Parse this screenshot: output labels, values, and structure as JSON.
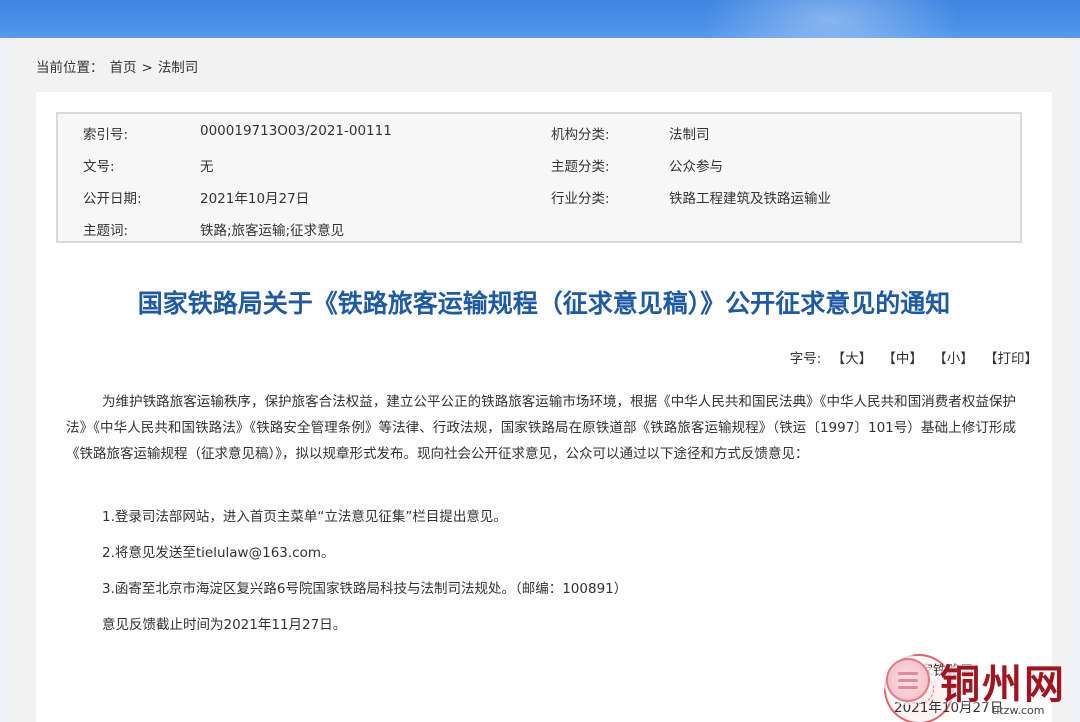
{
  "breadcrumb": {
    "prefix": "当前位置：",
    "home": "首页",
    "separator": ">",
    "current": "法制司"
  },
  "meta": {
    "rows": [
      {
        "k1": "索引号:",
        "v1": "000019713O03/2021-00111",
        "k2": "机构分类:",
        "v2": "法制司"
      },
      {
        "k1": "文号:",
        "v1": "无",
        "k2": "主题分类:",
        "v2": "公众参与"
      },
      {
        "k1": "公开日期:",
        "v1": "2021年10月27日",
        "k2": "行业分类:",
        "v2": "铁路工程建筑及铁路运输业"
      },
      {
        "k1": "主题词:",
        "v1": "铁路;旅客运输;征求意见",
        "k2": "",
        "v2": ""
      }
    ]
  },
  "article": {
    "title": "国家铁路局关于《铁路旅客运输规程（征求意见稿）》公开征求意见的通知",
    "fontsize": {
      "label": "字号:",
      "large": "【大】",
      "medium": "【中】",
      "small": "【小】",
      "print": "【打印】"
    },
    "intro": "为维护铁路旅客运输秩序，保护旅客合法权益，建立公平公正的铁路旅客运输市场环境，根据《中华人民共和国民法典》《中华人民共和国消费者权益保护法》《中华人民共和国铁路法》《铁路安全管理条例》等法律、行政法规，国家铁路局在原铁道部《铁路旅客运输规程》（铁运〔1997〕101号）基础上修订形成《铁路旅客运输规程（征求意见稿）》，拟以规章形式发布。现向社会公开征求意见，公众可以通过以下途径和方式反馈意见：",
    "items": [
      "1.登录司法部网站，进入首页主菜单“立法意见征集”栏目提出意见。",
      "2.将意见发送至tielulaw@163.com。",
      "3.函寄至北京市海淀区复兴路6号院国家铁路局科技与法制司法规处。（邮编：100891）",
      "意见反馈截止时间为2021年11月27日。"
    ],
    "signature": "国家铁路局",
    "sign_date": "2021年10月27日"
  },
  "watermark": {
    "text": "铜州网",
    "url": "tltzw.com"
  },
  "colors": {
    "header_blue": "#4a90e8",
    "title_blue": "#1f5aa6",
    "seal_red": "#d6323c",
    "watermark_red": "#a2141f"
  }
}
